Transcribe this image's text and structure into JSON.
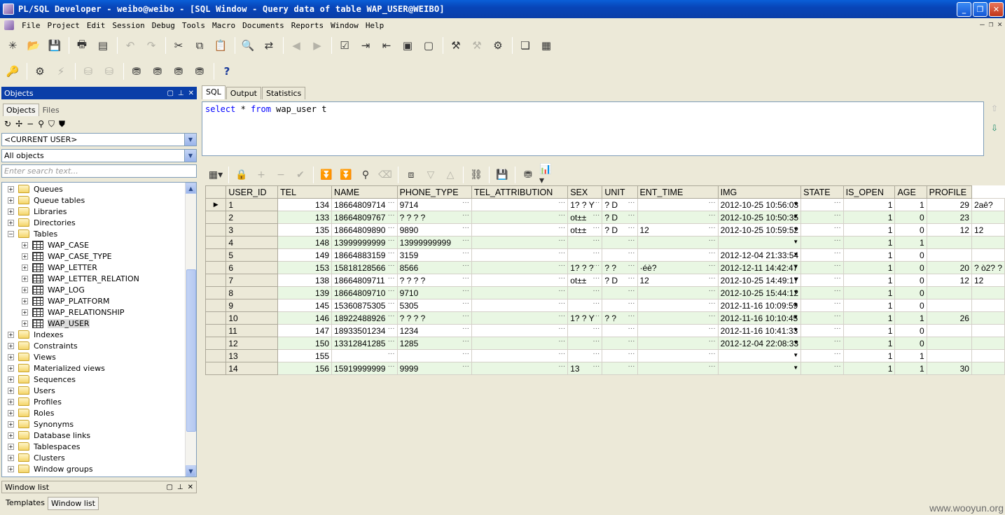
{
  "window": {
    "title": "PL/SQL Developer - weibo@weibo - [SQL Window - Query data of table WAP_USER@WEIBO]"
  },
  "menu": [
    "File",
    "Project",
    "Edit",
    "Session",
    "Debug",
    "Tools",
    "Macro",
    "Documents",
    "Reports",
    "Window",
    "Help"
  ],
  "objects_panel": {
    "title": "Objects",
    "tabs": [
      "Objects",
      "Files"
    ],
    "owner_select": "<CURRENT USER>",
    "filter_select": "All objects",
    "search_placeholder": "Enter search text...",
    "tree": [
      {
        "label": "Queues",
        "type": "folder",
        "level": 0
      },
      {
        "label": "Queue tables",
        "type": "folder",
        "level": 0
      },
      {
        "label": "Libraries",
        "type": "folder",
        "level": 0
      },
      {
        "label": "Directories",
        "type": "folder",
        "level": 0
      },
      {
        "label": "Tables",
        "type": "folder",
        "level": 0,
        "expanded": true
      },
      {
        "label": "WAP_CASE",
        "type": "table",
        "level": 1
      },
      {
        "label": "WAP_CASE_TYPE",
        "type": "table",
        "level": 1
      },
      {
        "label": "WAP_LETTER",
        "type": "table",
        "level": 1
      },
      {
        "label": "WAP_LETTER_RELATION",
        "type": "table",
        "level": 1
      },
      {
        "label": "WAP_LOG",
        "type": "table",
        "level": 1
      },
      {
        "label": "WAP_PLATFORM",
        "type": "table",
        "level": 1
      },
      {
        "label": "WAP_RELATIONSHIP",
        "type": "table",
        "level": 1
      },
      {
        "label": "WAP_USER",
        "type": "table",
        "level": 1,
        "selected": true
      },
      {
        "label": "Indexes",
        "type": "folder",
        "level": 0
      },
      {
        "label": "Constraints",
        "type": "folder",
        "level": 0
      },
      {
        "label": "Views",
        "type": "folder",
        "level": 0
      },
      {
        "label": "Materialized views",
        "type": "folder",
        "level": 0
      },
      {
        "label": "Sequences",
        "type": "folder",
        "level": 0
      },
      {
        "label": "Users",
        "type": "folder",
        "level": 0
      },
      {
        "label": "Profiles",
        "type": "folder",
        "level": 0
      },
      {
        "label": "Roles",
        "type": "folder",
        "level": 0
      },
      {
        "label": "Synonyms",
        "type": "folder",
        "level": 0
      },
      {
        "label": "Database links",
        "type": "folder",
        "level": 0
      },
      {
        "label": "Tablespaces",
        "type": "folder",
        "level": 0
      },
      {
        "label": "Clusters",
        "type": "folder",
        "level": 0
      },
      {
        "label": "Window groups",
        "type": "folder",
        "level": 0
      }
    ]
  },
  "window_list_panel": {
    "title": "Window list",
    "tabs": [
      "Templates",
      "Window list"
    ]
  },
  "sql_tabs": [
    "SQL",
    "Output",
    "Statistics"
  ],
  "sql": {
    "kw1": "select",
    "rest1": " * ",
    "kw2": "from",
    "rest2": " wap_user t"
  },
  "grid": {
    "columns": [
      "USER_ID",
      "TEL",
      "NAME",
      "PHONE_TYPE",
      "TEL_ATTRIBUTION",
      "SEX",
      "UNIT",
      "ENT_TIME",
      "IMG",
      "STATE",
      "IS_OPEN",
      "AGE",
      "PROFILE"
    ],
    "rows": [
      [
        "1",
        "134",
        "18664809714",
        "9714",
        "",
        "1? ? Y",
        "? D",
        "",
        "2012-10-25 10:56:03",
        "",
        "1",
        "1",
        "29",
        "2aê?"
      ],
      [
        "2",
        "133",
        "18664809767",
        "? ? ? ?",
        "",
        "ot±±",
        "? D",
        "",
        "2012-10-25 10:50:35",
        "",
        "1",
        "0",
        "23",
        ""
      ],
      [
        "3",
        "135",
        "18664809890",
        "9890",
        "",
        "ot±±",
        "? D",
        "12",
        "2012-10-25 10:59:52",
        "",
        "1",
        "0",
        "12",
        "12"
      ],
      [
        "4",
        "148",
        "13999999999",
        "13999999999",
        "",
        "",
        "",
        "",
        "",
        "",
        "1",
        "1",
        "",
        ""
      ],
      [
        "5",
        "149",
        "18664883159",
        "3159",
        "",
        "",
        "",
        "",
        "2012-12-04 21:33:54",
        "",
        "1",
        "0",
        "",
        ""
      ],
      [
        "6",
        "153",
        "15818128566",
        "8566",
        "",
        "1? ? ?",
        "? ?",
        "·éè?",
        "2012-12-11 14:42:47",
        "",
        "1",
        "0",
        "20",
        "? ò2? ?"
      ],
      [
        "7",
        "138",
        "18664809711",
        "? ? ? ?",
        "",
        "ot±±",
        "? D",
        "12",
        "2012-10-25 14:49:17",
        "",
        "1",
        "0",
        "12",
        "12"
      ],
      [
        "8",
        "139",
        "18664809710",
        "9710",
        "",
        "",
        "",
        "",
        "2012-10-25 15:44:12",
        "",
        "1",
        "0",
        "",
        ""
      ],
      [
        "9",
        "145",
        "15360875305",
        "5305",
        "",
        "",
        "",
        "",
        "2012-11-16 10:09:59",
        "",
        "1",
        "0",
        "",
        ""
      ],
      [
        "10",
        "146",
        "18922488926",
        "? ? ? ?",
        "",
        "1? ? Y",
        "? ?",
        "",
        "2012-11-16 10:10:45",
        "",
        "1",
        "1",
        "26",
        ""
      ],
      [
        "11",
        "147",
        "18933501234",
        "1234",
        "",
        "",
        "",
        "",
        "2012-11-16 10:41:33",
        "",
        "1",
        "0",
        "",
        ""
      ],
      [
        "12",
        "150",
        "13312841285",
        "1285",
        "",
        "",
        "",
        "",
        "2012-12-04 22:08:33",
        "",
        "1",
        "0",
        "",
        ""
      ],
      [
        "13",
        "155",
        "",
        "",
        "",
        "",
        "",
        "",
        "",
        "",
        "1",
        "1",
        "",
        ""
      ],
      [
        "14",
        "156",
        "15919999999",
        "9999",
        "",
        "13",
        "",
        "",
        "",
        "",
        "1",
        "1",
        "30",
        ""
      ]
    ]
  },
  "watermark": "www.wooyun.org"
}
